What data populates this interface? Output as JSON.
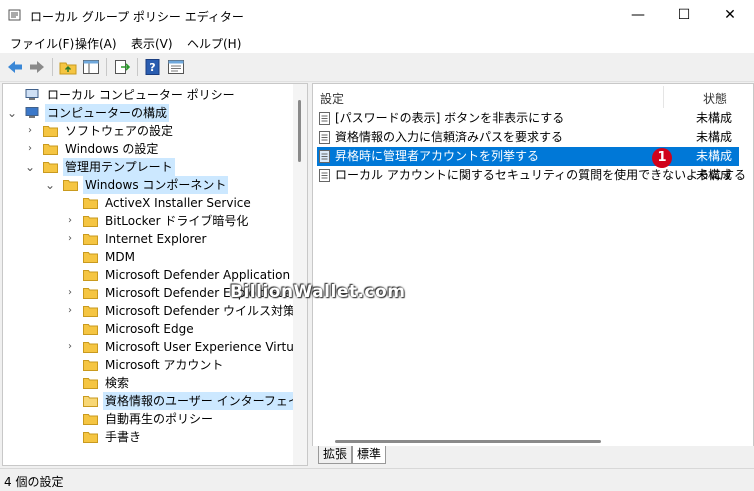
{
  "window": {
    "title": "ローカル グループ ポリシー エディター",
    "minimize": "—",
    "maximize": "☐",
    "close": "✕"
  },
  "menu": [
    "ファイル(F)",
    "操作(A)",
    "表示(V)",
    "ヘルプ(H)"
  ],
  "toolbar": [
    "back-icon",
    "forward-icon",
    "up-folder-icon",
    "show-hide-tree-icon",
    "export-list-icon",
    "help-icon",
    "properties-icon"
  ],
  "tree": [
    {
      "label": "ローカル コンピューター ポリシー",
      "icon": "computer-icon",
      "level": 0,
      "expand": "",
      "selected": false
    },
    {
      "label": "コンピューターの構成",
      "icon": "computer-config-icon",
      "level": 0,
      "expand": "open",
      "selected": true
    },
    {
      "label": "ソフトウェアの設定",
      "icon": "folder-icon",
      "level": 1,
      "expand": "closed",
      "selected": false
    },
    {
      "label": "Windows の設定",
      "icon": "folder-icon",
      "level": 1,
      "expand": "closed",
      "selected": false
    },
    {
      "label": "管理用テンプレート",
      "icon": "folder-icon",
      "level": 1,
      "expand": "open",
      "selected": true
    },
    {
      "label": "Windows コンポーネント",
      "icon": "folder-icon",
      "level": 2,
      "expand": "open",
      "selected": true
    },
    {
      "label": "ActiveX Installer Service",
      "icon": "folder-icon",
      "level": 3,
      "expand": "",
      "selected": false
    },
    {
      "label": "BitLocker ドライブ暗号化",
      "icon": "folder-icon",
      "level": 3,
      "expand": "closed",
      "selected": false
    },
    {
      "label": "Internet Explorer",
      "icon": "folder-icon",
      "level": 3,
      "expand": "closed",
      "selected": false
    },
    {
      "label": "MDM",
      "icon": "folder-icon",
      "level": 3,
      "expand": "",
      "selected": false
    },
    {
      "label": "Microsoft Defender Application Gua",
      "icon": "folder-icon",
      "level": 3,
      "expand": "",
      "selected": false
    },
    {
      "label": "Microsoft Defender Exploit Guard",
      "icon": "folder-icon",
      "level": 3,
      "expand": "closed",
      "selected": false
    },
    {
      "label": "Microsoft Defender ウイルス対策",
      "icon": "folder-icon",
      "level": 3,
      "expand": "closed",
      "selected": false
    },
    {
      "label": "Microsoft Edge",
      "icon": "folder-icon",
      "level": 3,
      "expand": "",
      "selected": false
    },
    {
      "label": "Microsoft User Experience Virtualiza",
      "icon": "folder-icon",
      "level": 3,
      "expand": "closed",
      "selected": false
    },
    {
      "label": "Microsoft アカウント",
      "icon": "folder-icon",
      "level": 3,
      "expand": "",
      "selected": false
    },
    {
      "label": "検索",
      "icon": "folder-icon",
      "level": 3,
      "expand": "",
      "selected": false
    },
    {
      "label": "資格情報のユーザー インターフェイス",
      "icon": "folder-open-icon",
      "level": 3,
      "expand": "",
      "selected": true
    },
    {
      "label": "自動再生のポリシー",
      "icon": "folder-icon",
      "level": 3,
      "expand": "",
      "selected": false
    },
    {
      "label": "手書き",
      "icon": "folder-icon",
      "level": 3,
      "expand": "",
      "selected": false
    }
  ],
  "list": {
    "col_setting": "設定",
    "col_state": "状態",
    "rows": [
      {
        "label": "[パスワードの表示] ボタンを非表示にする",
        "state": "未構成",
        "highlight": false
      },
      {
        "label": "資格情報の入力に信頼済みパスを要求する",
        "state": "未構成",
        "highlight": false
      },
      {
        "label": "昇格時に管理者アカウントを列挙する",
        "state": "未構成",
        "highlight": true
      },
      {
        "label": "ローカル アカウントに関するセキュリティの質問を使用できないようにする",
        "state": "未構成",
        "highlight": false
      }
    ],
    "badge": "1"
  },
  "tabs": [
    "拡張",
    "標準"
  ],
  "status": "4 個の設定",
  "watermark": "BillionWallet.com",
  "colors": {
    "highlight": "#0078d7",
    "selection": "#cce8ff",
    "badge": "#d0021b",
    "folder": "#f5c542"
  }
}
